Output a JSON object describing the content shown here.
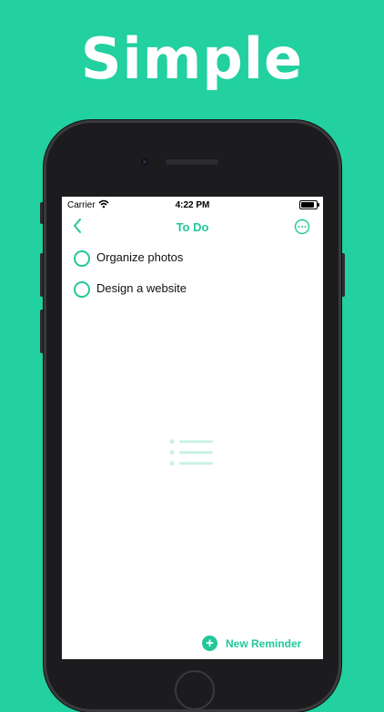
{
  "promo": {
    "headline": "Simple"
  },
  "status_bar": {
    "carrier": "Carrier",
    "time": "4:22 PM"
  },
  "nav": {
    "title": "To Do",
    "back_icon": "chevron-left-icon",
    "more_icon": "ellipsis-circle-icon"
  },
  "reminders": [
    {
      "title": "Organize photos",
      "completed": false
    },
    {
      "title": "Design a website",
      "completed": false
    }
  ],
  "empty_state_icon": "list-icon",
  "footer": {
    "new_reminder_label": "New Reminder",
    "icon": "plus-circle-icon"
  },
  "colors": {
    "accent": "#22c79a",
    "background": "#22d0a0"
  }
}
